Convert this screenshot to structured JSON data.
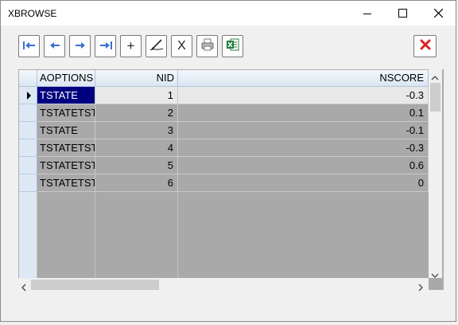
{
  "window": {
    "title": "XBROWSE"
  },
  "toolbar": {
    "buttons": [
      {
        "name": "first-record-button",
        "icon": "first-record-icon"
      },
      {
        "name": "prev-record-button",
        "icon": "prev-record-icon"
      },
      {
        "name": "next-record-button",
        "icon": "next-record-icon"
      },
      {
        "name": "last-record-button",
        "icon": "last-record-icon"
      },
      {
        "name": "add-record-button",
        "icon": "plus-icon",
        "label": "+"
      },
      {
        "name": "edit-record-button",
        "icon": "pen-edit-icon"
      },
      {
        "name": "delete-record-button",
        "icon": "x-icon",
        "label": "X"
      },
      {
        "name": "print-button",
        "icon": "printer-icon"
      },
      {
        "name": "export-excel-button",
        "icon": "excel-icon"
      },
      {
        "name": "close-button",
        "icon": "red-close-icon"
      }
    ],
    "accent_color": "#e02020"
  },
  "table": {
    "headers": [
      "AOPTIONS",
      "NID",
      "NSCORE"
    ],
    "rows": [
      {
        "aoptions": "TSTATE",
        "nid": "1",
        "nscore": "-0.3",
        "selected": true
      },
      {
        "aoptions": "TSTATETST",
        "nid": "2",
        "nscore": "0.1"
      },
      {
        "aoptions": "TSTATE",
        "nid": "3",
        "nscore": "-0.1"
      },
      {
        "aoptions": "TSTATETST",
        "nid": "4",
        "nscore": "-0.3"
      },
      {
        "aoptions": "TSTATETST",
        "nid": "5",
        "nscore": "0.6"
      },
      {
        "aoptions": "TSTATETST",
        "nid": "6",
        "nscore": "0"
      }
    ],
    "selected_bg": "#000080",
    "row_bg_selected": "#e8e8e8",
    "row_bg": "#a9a9a9"
  }
}
